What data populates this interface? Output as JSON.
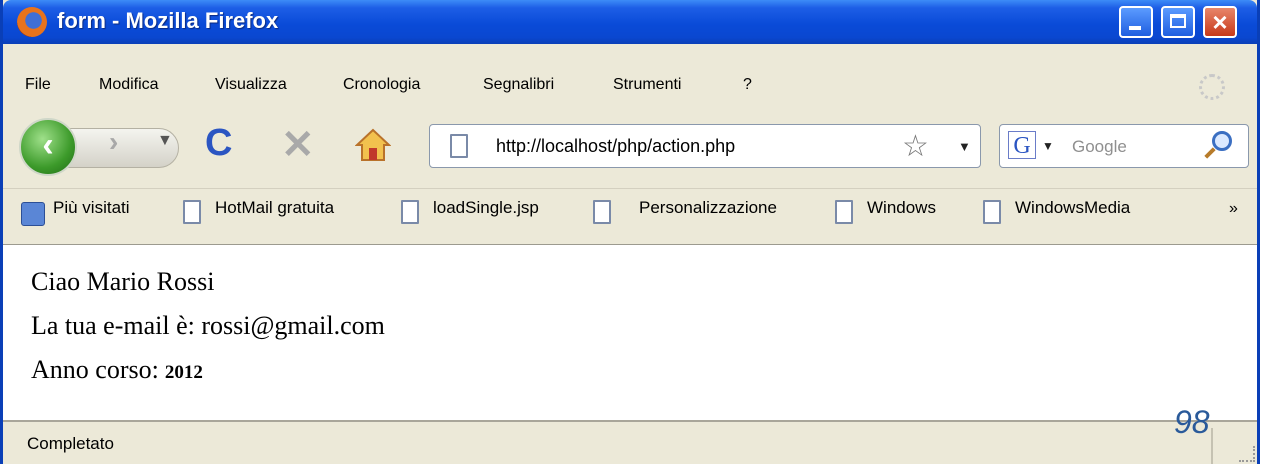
{
  "window": {
    "title": "form - Mozilla Firefox"
  },
  "menu": [
    "File",
    "Modifica",
    "Visualizza",
    "Cronologia",
    "Segnalibri",
    "Strumenti",
    "?"
  ],
  "nav": {
    "url": "http://localhost/php/action.php",
    "search_placeholder": "Google"
  },
  "bookmarks": [
    "Più visitati",
    "HotMail gratuita",
    "loadSingle.jsp",
    "Personalizzazione",
    "Windows",
    "WindowsMedia"
  ],
  "bookmarks_more": "»",
  "content": {
    "line1": "Ciao Mario Rossi",
    "line2": "La tua e-mail è: rossi@gmail.com",
    "line3_label": "Anno corso:",
    "line3_value": "2012"
  },
  "status": {
    "text": "Completato"
  },
  "slide_number": "98",
  "colors": {
    "titlebar": "#0a4bd8",
    "reload": "#2b55c2",
    "back": "#3c9a2a"
  }
}
